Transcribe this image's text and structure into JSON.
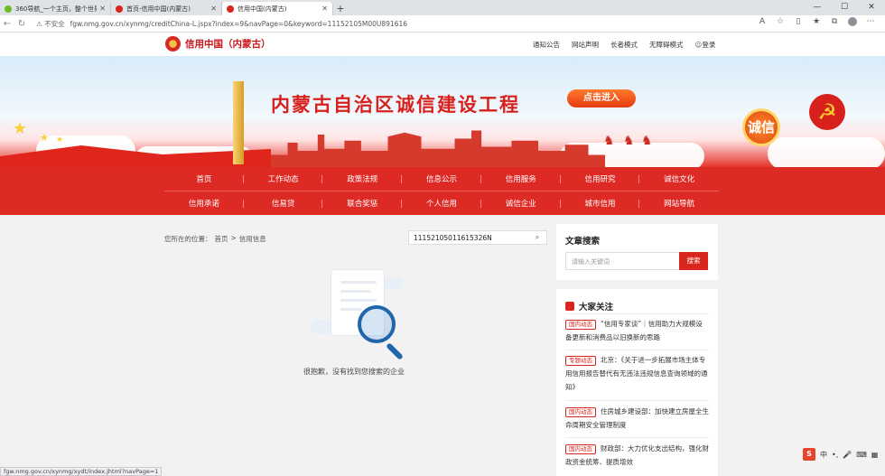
{
  "browser": {
    "tabs": [
      {
        "label": "360导航_一个主页，整个世界",
        "color": "#6fba2c",
        "active": false
      },
      {
        "label": "首页-信用中国(内蒙古)",
        "color": "#d8261f",
        "active": false
      },
      {
        "label": "信用中国(内蒙古)",
        "color": "#d8261f",
        "active": true
      }
    ],
    "insecure_label": "不安全",
    "url": "fgw.nmg.gov.cn/xynmg/creditChina-L.jspx?index=9&navPage=0&keyword=11152105M00U891616"
  },
  "site": {
    "logo_text": "信用中国（内蒙古）",
    "toplinks": [
      "通知公告",
      "网站声明",
      "长者模式",
      "无障碍模式"
    ],
    "login": "登录"
  },
  "banner": {
    "title": "内蒙古自治区诚信建设工程",
    "enter_button": "点击进入",
    "seal_text": "诚信"
  },
  "nav": {
    "row1": [
      "首页",
      "工作动态",
      "政策法规",
      "信息公示",
      "信用服务",
      "信用研究",
      "诚信文化"
    ],
    "row2": [
      "信用承诺",
      "信易贷",
      "联合奖惩",
      "个人信用",
      "诚信企业",
      "城市信用",
      "网站导航"
    ]
  },
  "main": {
    "breadcrumb_label": "您所在的位置：",
    "breadcrumb": [
      "首页",
      ">",
      "信用信息"
    ],
    "search_value": "11152105011615326N",
    "empty_message": "很抱歉，没有找到您搜索的企业"
  },
  "article_search": {
    "title": "文章搜索",
    "placeholder": "请输入关键词",
    "button": "搜索"
  },
  "hot": {
    "title": "大家关注",
    "items": [
      {
        "tag": "国内动态",
        "text": "“信用专家谈”｜信用助力大规模设备更新和消费品以旧换新的思路"
      },
      {
        "tag": "专题动态",
        "text": "北京：《关于进一步拓展市场主体专用信用报告替代有无违法违规信息查询领域的通知》"
      },
      {
        "tag": "国内动态",
        "text": "住房城乡建设部：加快建立房屋全生命周期安全管理制度"
      },
      {
        "tag": "国内动态",
        "text": "财政部：大力优化支出结构，强化财政资金统筹、提质增效"
      }
    ]
  },
  "status_url": "fgw.nmg.gov.cn/xynmg/xydt/index.jhtml?navPage=1",
  "ime": {
    "zh": "中"
  }
}
